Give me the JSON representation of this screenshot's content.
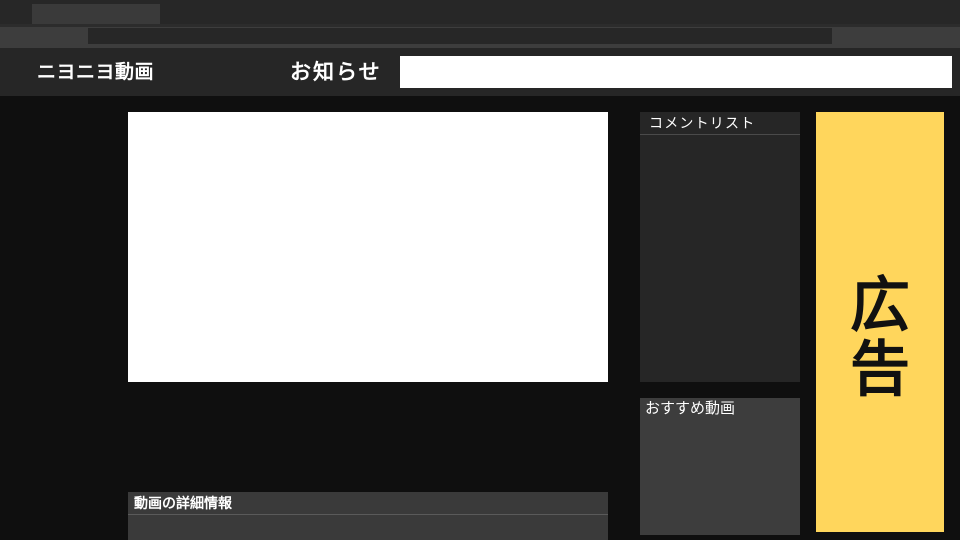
{
  "site": {
    "logo": "ニヨニヨ動画",
    "notice_label": "お知らせ"
  },
  "panels": {
    "comment_list_title": "コメントリスト",
    "recommended_title": "おすすめ動画",
    "details_title": "動画の詳細情報"
  },
  "ad": {
    "line1": "広",
    "line2": "告",
    "color": "#ffd65c"
  }
}
